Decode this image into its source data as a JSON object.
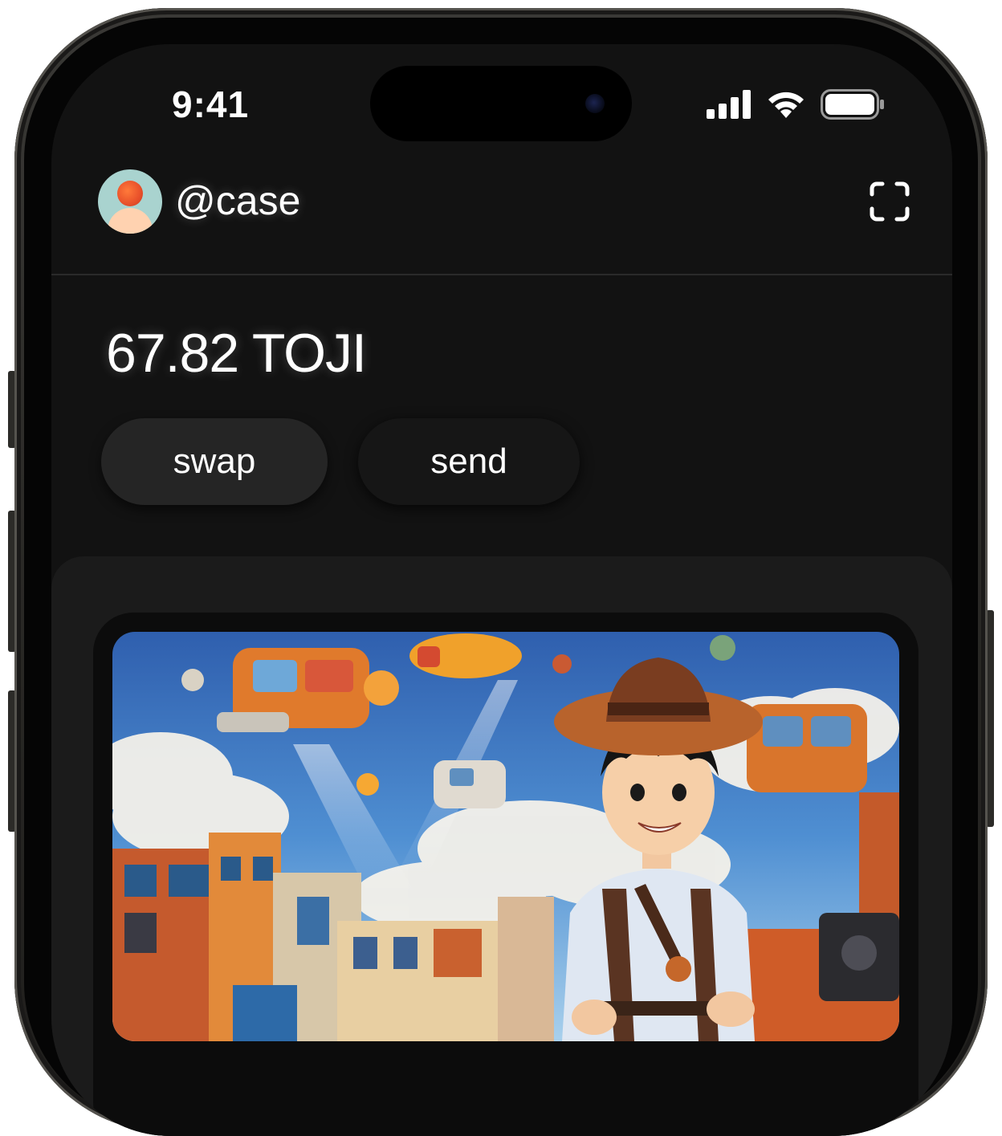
{
  "status_bar": {
    "time": "9:41"
  },
  "header": {
    "username": "@case"
  },
  "wallet": {
    "balance": "67.82 TOJI"
  },
  "actions": {
    "swap_label": "swap",
    "send_label": "send"
  },
  "icons": {
    "avatar": "profile-avatar",
    "scan": "scan-frame-icon",
    "signal": "cellular-signal-icon",
    "wifi": "wifi-icon",
    "battery": "battery-icon"
  },
  "colors": {
    "screen_bg": "#121212",
    "button_bg": "#252525",
    "card_bg": "#1b1b1b",
    "text": "#ffffff"
  }
}
